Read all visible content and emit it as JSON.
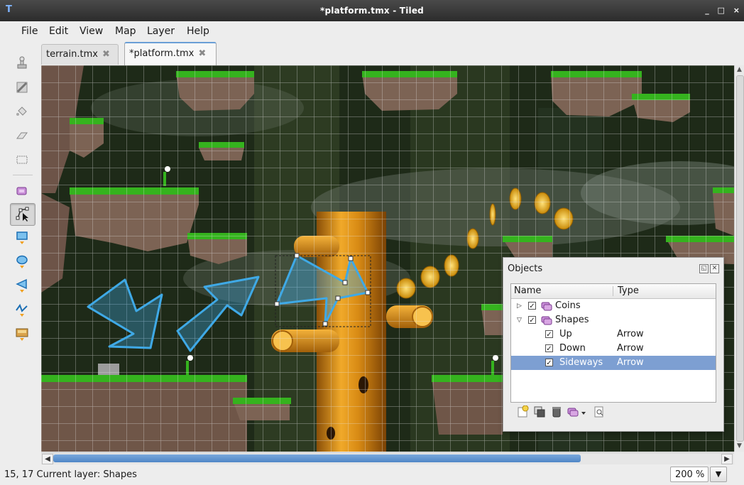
{
  "window": {
    "title": "*platform.tmx - Tiled",
    "controls": [
      "_",
      "□",
      "×"
    ]
  },
  "menu": [
    {
      "label": "File"
    },
    {
      "label": "Edit"
    },
    {
      "label": "View"
    },
    {
      "label": "Map"
    },
    {
      "label": "Layer"
    },
    {
      "label": "Help"
    }
  ],
  "tools": [
    {
      "icon": "stamp-brush-icon"
    },
    {
      "icon": "terrain-brush-icon"
    },
    {
      "icon": "bucket-fill-icon"
    },
    {
      "icon": "eraser-icon"
    },
    {
      "icon": "rectangular-select-icon"
    },
    {
      "icon": "select-objects-icon"
    },
    {
      "icon": "edit-polygons-icon",
      "active": true
    },
    {
      "icon": "insert-rectangle-icon"
    },
    {
      "icon": "insert-ellipse-icon"
    },
    {
      "icon": "insert-polygon-icon"
    },
    {
      "icon": "insert-polyline-icon"
    },
    {
      "icon": "insert-tile-icon"
    }
  ],
  "tabs": [
    {
      "label": "terrain.tmx",
      "close": "✖",
      "active": false
    },
    {
      "label": "*platform.tmx",
      "close": "✖",
      "active": true
    }
  ],
  "objects_panel": {
    "title": "Objects",
    "columns": {
      "name": "Name",
      "type": "Type"
    },
    "rows": [
      {
        "name": "Coins",
        "type": "",
        "checked": true,
        "expanded": false,
        "level": 0,
        "selected": false
      },
      {
        "name": "Shapes",
        "type": "",
        "checked": true,
        "expanded": true,
        "level": 0,
        "selected": false
      },
      {
        "name": "Up",
        "type": "Arrow",
        "checked": true,
        "level": 1,
        "selected": false
      },
      {
        "name": "Down",
        "type": "Arrow",
        "checked": true,
        "level": 1,
        "selected": false
      },
      {
        "name": "Sideways",
        "type": "Arrow",
        "checked": true,
        "level": 1,
        "selected": true
      }
    ],
    "footer_icons": [
      "new-object-layer-icon",
      "duplicate-objects-icon",
      "remove-objects-icon",
      "move-to-layer-icon",
      "object-properties-icon"
    ]
  },
  "status": {
    "coords": "15, 17",
    "layer_text": "Current layer: Shapes"
  },
  "zoom": {
    "value": "200 %"
  },
  "colors": {
    "accent": "#4f86c6",
    "selection": "#7d9fd2",
    "shape_stroke": "#3fa9e6"
  }
}
